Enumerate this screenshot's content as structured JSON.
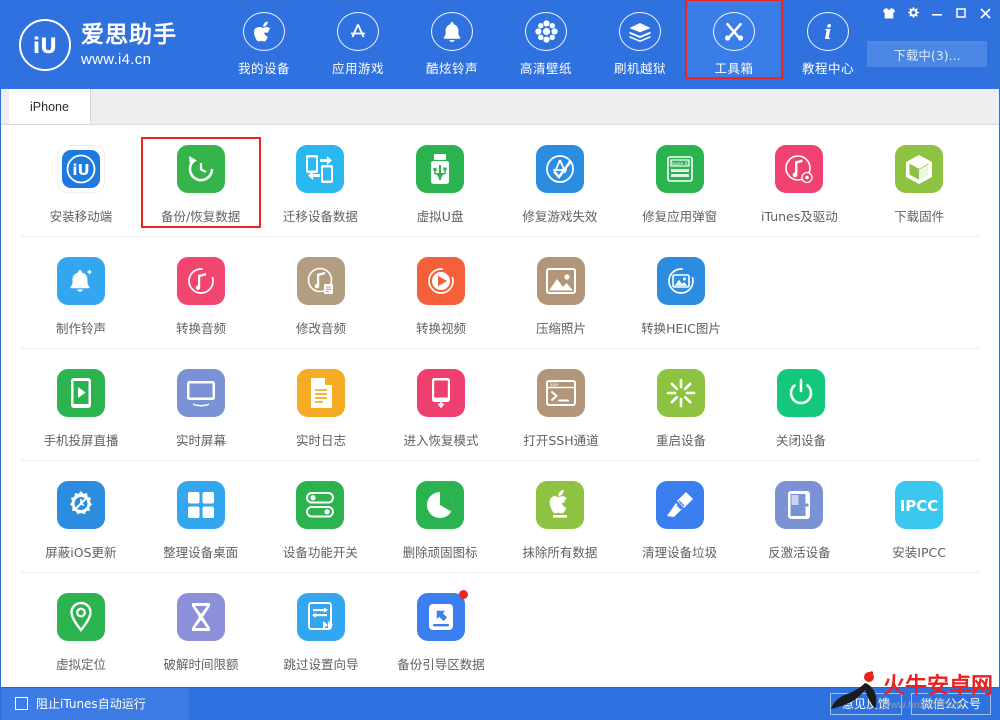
{
  "window": {
    "title": "爱思助手",
    "logo_url": "www.i4.cn",
    "logo_mark": "iU",
    "download_button": "下载中(3)...",
    "controls": [
      {
        "name": "skin-icon",
        "glyph": "shirt"
      },
      {
        "name": "settings-icon",
        "glyph": "gear"
      },
      {
        "name": "minimize-icon",
        "glyph": "minimize"
      },
      {
        "name": "maximize-icon",
        "glyph": "maximize"
      },
      {
        "name": "close-icon",
        "glyph": "close"
      }
    ]
  },
  "nav": {
    "items": [
      {
        "label": "我的设备",
        "icon": "apple-icon",
        "active": false
      },
      {
        "label": "应用游戏",
        "icon": "appstore-icon",
        "active": false
      },
      {
        "label": "酷炫铃声",
        "icon": "bell-icon",
        "active": false
      },
      {
        "label": "高清壁纸",
        "icon": "flower-icon",
        "active": false
      },
      {
        "label": "刷机越狱",
        "icon": "cydia-box-icon",
        "active": false
      },
      {
        "label": "工具箱",
        "icon": "wrench-tools-icon",
        "active": true
      },
      {
        "label": "教程中心",
        "icon": "info-icon",
        "active": false
      }
    ],
    "accent_highlight": "#ee2420"
  },
  "tabs": {
    "items": [
      {
        "label": "iPhone",
        "selected": true
      }
    ]
  },
  "toolbox": {
    "rows": [
      {
        "tools": [
          {
            "label": "安装移动端",
            "icon": "i4-app-icon",
            "bg": "#ffffff",
            "fg": "#1f7ae0",
            "highlight": false,
            "badge": false
          },
          {
            "label": "备份/恢复数据",
            "icon": "backup-restore-icon",
            "bg": "#34b44a",
            "fg": "#ffffff",
            "highlight": true,
            "badge": false
          },
          {
            "label": "迁移设备数据",
            "icon": "device-migrate-icon",
            "bg": "#2bb8f0",
            "fg": "#ffffff",
            "highlight": false,
            "badge": false
          },
          {
            "label": "虚拟U盘",
            "icon": "usb-drive-icon",
            "bg": "#2bb34f",
            "fg": "#ffffff",
            "highlight": false,
            "badge": false
          },
          {
            "label": "修复游戏失效",
            "icon": "appstore-check-icon",
            "bg": "#2b8ce0",
            "fg": "#ffffff",
            "highlight": false,
            "badge": false
          },
          {
            "label": "修复应用弹窗",
            "icon": "apple-id-card-icon",
            "bg": "#2bb34f",
            "fg": "#ffffff",
            "highlight": false,
            "badge": false
          },
          {
            "label": "iTunes及驱动",
            "icon": "itunes-gear-icon",
            "bg": "#f0426e",
            "fg": "#ffffff",
            "highlight": false,
            "badge": false
          },
          {
            "label": "下载固件",
            "icon": "firmware-cube-icon",
            "bg": "#8dc340",
            "fg": "#ffffff",
            "highlight": false,
            "badge": false
          }
        ]
      },
      {
        "tools": [
          {
            "label": "制作铃声",
            "icon": "ringtone-bell-icon",
            "bg": "#34a6f0",
            "fg": "#ffffff",
            "highlight": false,
            "badge": false
          },
          {
            "label": "转换音频",
            "icon": "audio-convert-icon",
            "bg": "#f2456f",
            "fg": "#ffffff",
            "highlight": false,
            "badge": false
          },
          {
            "label": "修改音频",
            "icon": "audio-edit-icon",
            "bg": "#b39d80",
            "fg": "#ffffff",
            "highlight": false,
            "badge": false
          },
          {
            "label": "转换视频",
            "icon": "video-convert-icon",
            "bg": "#f3603a",
            "fg": "#ffffff",
            "highlight": false,
            "badge": false
          },
          {
            "label": "压缩照片",
            "icon": "photo-compress-icon",
            "bg": "#b3967a",
            "fg": "#ffffff",
            "highlight": false,
            "badge": false
          },
          {
            "label": "转换HEIC图片",
            "icon": "heic-convert-icon",
            "bg": "#2b8ce0",
            "fg": "#ffffff",
            "highlight": false,
            "badge": false
          }
        ]
      },
      {
        "tools": [
          {
            "label": "手机投屏直播",
            "icon": "screen-cast-icon",
            "bg": "#2bb34f",
            "fg": "#ffffff",
            "highlight": false,
            "badge": false
          },
          {
            "label": "实时屏幕",
            "icon": "monitor-icon",
            "bg": "#7b93d4",
            "fg": "#ffffff",
            "highlight": false,
            "badge": false
          },
          {
            "label": "实时日志",
            "icon": "log-document-icon",
            "bg": "#f5a githubb23",
            "fg": "#ffffff",
            "highlight": false,
            "badge": false
          },
          {
            "label": "进入恢复模式",
            "icon": "recovery-mode-icon",
            "bg": "#ef3f6e",
            "fg": "#ffffff",
            "highlight": false,
            "badge": false
          },
          {
            "label": "打开SSH通道",
            "icon": "ssh-terminal-icon",
            "bg": "#b3967a",
            "fg": "#ffffff",
            "highlight": false,
            "badge": false
          },
          {
            "label": "重启设备",
            "icon": "restart-icon",
            "bg": "#8dc340",
            "fg": "#ffffff",
            "highlight": false,
            "badge": false
          },
          {
            "label": "关闭设备",
            "icon": "power-off-icon",
            "bg": "#13c87a",
            "fg": "#ffffff",
            "highlight": false,
            "badge": false
          }
        ]
      },
      {
        "tools": [
          {
            "label": "屏蔽iOS更新",
            "icon": "block-update-icon",
            "bg": "#2b8ce0",
            "fg": "#ffffff",
            "highlight": false,
            "badge": false
          },
          {
            "label": "整理设备桌面",
            "icon": "arrange-desktop-icon",
            "bg": "#34a6f0",
            "fg": "#ffffff",
            "highlight": false,
            "badge": false
          },
          {
            "label": "设备功能开关",
            "icon": "feature-toggle-icon",
            "bg": "#2bb34f",
            "fg": "#ffffff",
            "highlight": false,
            "badge": false
          },
          {
            "label": "删除顽固图标",
            "icon": "remove-icon-icon",
            "bg": "#2bb34f",
            "fg": "#ffffff",
            "highlight": false,
            "badge": false
          },
          {
            "label": "抹除所有数据",
            "icon": "erase-all-icon",
            "bg": "#8dc340",
            "fg": "#ffffff",
            "highlight": false,
            "badge": false
          },
          {
            "label": "清理设备垃圾",
            "icon": "clean-junk-icon",
            "bg": "#3a7ef0",
            "fg": "#ffffff",
            "highlight": false,
            "badge": false
          },
          {
            "label": "反激活设备",
            "icon": "deactivate-icon",
            "bg": "#7b93d4",
            "fg": "#ffffff",
            "highlight": false,
            "badge": false
          },
          {
            "label": "安装IPCC",
            "icon": "ipcc-icon",
            "bg": "#3cc8ee",
            "fg": "#ffffff",
            "highlight": false,
            "badge": false
          }
        ]
      },
      {
        "tools": [
          {
            "label": "虚拟定位",
            "icon": "location-pin-icon",
            "bg": "#2bb34f",
            "fg": "#ffffff",
            "highlight": false,
            "badge": false
          },
          {
            "label": "破解时间限额",
            "icon": "hourglass-icon",
            "bg": "#8b90d8",
            "fg": "#ffffff",
            "highlight": false,
            "badge": false
          },
          {
            "label": "跳过设置向导",
            "icon": "skip-setup-icon",
            "bg": "#34a6f0",
            "fg": "#ffffff",
            "highlight": false,
            "badge": false
          },
          {
            "label": "备份引导区数据",
            "icon": "backup-boot-icon",
            "bg": "#3a7ef0",
            "fg": "#ffffff",
            "highlight": false,
            "badge": true
          }
        ]
      }
    ]
  },
  "footer": {
    "checkbox_label": "阻止iTunes自动运行",
    "checkbox_checked": false,
    "buttons": [
      {
        "label": "意见反馈"
      },
      {
        "label": "微信公众号"
      }
    ]
  },
  "watermark": {
    "brand": "火牛安卓网",
    "url": "www.hnzzdt.com",
    "brand_color_1": "#e8231f",
    "brand_color_2": "#222222"
  }
}
